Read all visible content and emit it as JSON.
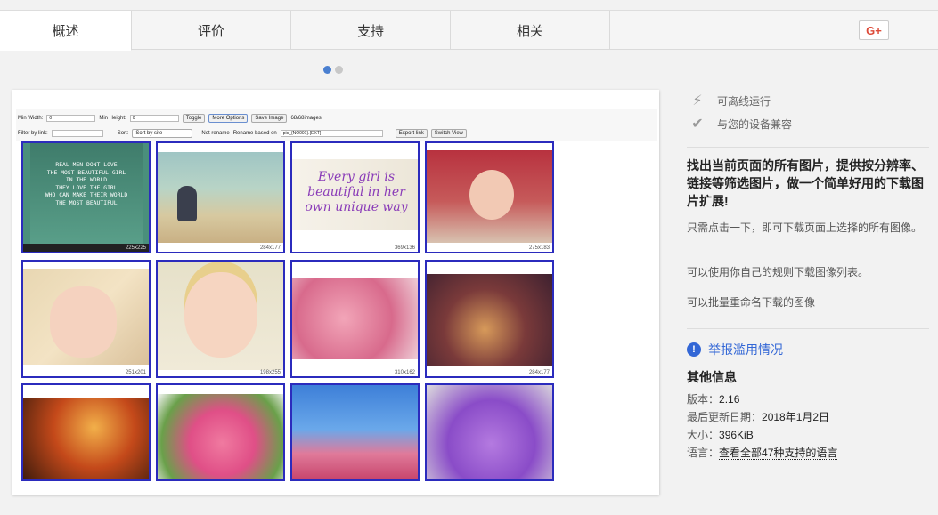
{
  "tabs": [
    {
      "label": "概述"
    },
    {
      "label": "评价"
    },
    {
      "label": "支持"
    },
    {
      "label": "相关"
    }
  ],
  "gplus_label": "G+",
  "screenshot": {
    "toolbar": {
      "min_width_label": "Min Width:",
      "min_width_value": "0",
      "min_height_label": "Min Height:",
      "min_height_value": "0",
      "toggle": "Toggle",
      "more_options": "More Options",
      "save_image": "Save Image",
      "count": "68/68images",
      "filter_label": "Filter by link:",
      "sort_label": "Sort:",
      "sort_value": "Sort by site",
      "not_rename": "Not rename",
      "rename_based_on": "Rename based on",
      "rename_pattern": "pic_{NO001}.{EXT}",
      "export_link": "Export link",
      "switch_view": "Switch View"
    },
    "images": [
      {
        "size": "225x225",
        "quote": "REAL MEN DONT LOVE\nTHE MOST BEAUTIFUL GIRL\nIN THE WORLD\nTHEY LOVE THE GIRL\nWHO CAN MAKE THEIR WORLD\nTHE MOST BEAUTIFUL"
      },
      {
        "size": "284x177"
      },
      {
        "size": "369x136",
        "quote": "Every girl is\nbeautiful in her\nown unique way"
      },
      {
        "size": "275x183"
      },
      {
        "size": "251x201"
      },
      {
        "size": "198x255"
      },
      {
        "size": "310x162"
      },
      {
        "size": "284x177"
      },
      {
        "size": ""
      },
      {
        "size": ""
      },
      {
        "size": ""
      },
      {
        "size": ""
      }
    ]
  },
  "sidebar": {
    "offline": "可离线运行",
    "compatible": "与您的设备兼容",
    "headline": "找出当前页面的所有图片，提供按分辨率、链接等筛选图片，做一个简单好用的下载图片扩展!",
    "para1": "只需点击一下，即可下载页面上选择的所有图像。",
    "para2": "可以使用你自己的规则下载图像列表。",
    "para3": "可以批量重命名下载的图像",
    "report": "举报滥用情况",
    "more_info_title": "其他信息",
    "version_label": "版本：",
    "version": "2.16",
    "updated_label": "最后更新日期：",
    "updated": "2018年1月2日",
    "size_label": "大小：",
    "size": "396KiB",
    "lang_label": "语言：",
    "lang": "查看全部47种支持的语言"
  },
  "colors": {
    "accent": "#3367d6",
    "frame": "#2b2bbd",
    "dot_active": "#4a7fd0"
  }
}
